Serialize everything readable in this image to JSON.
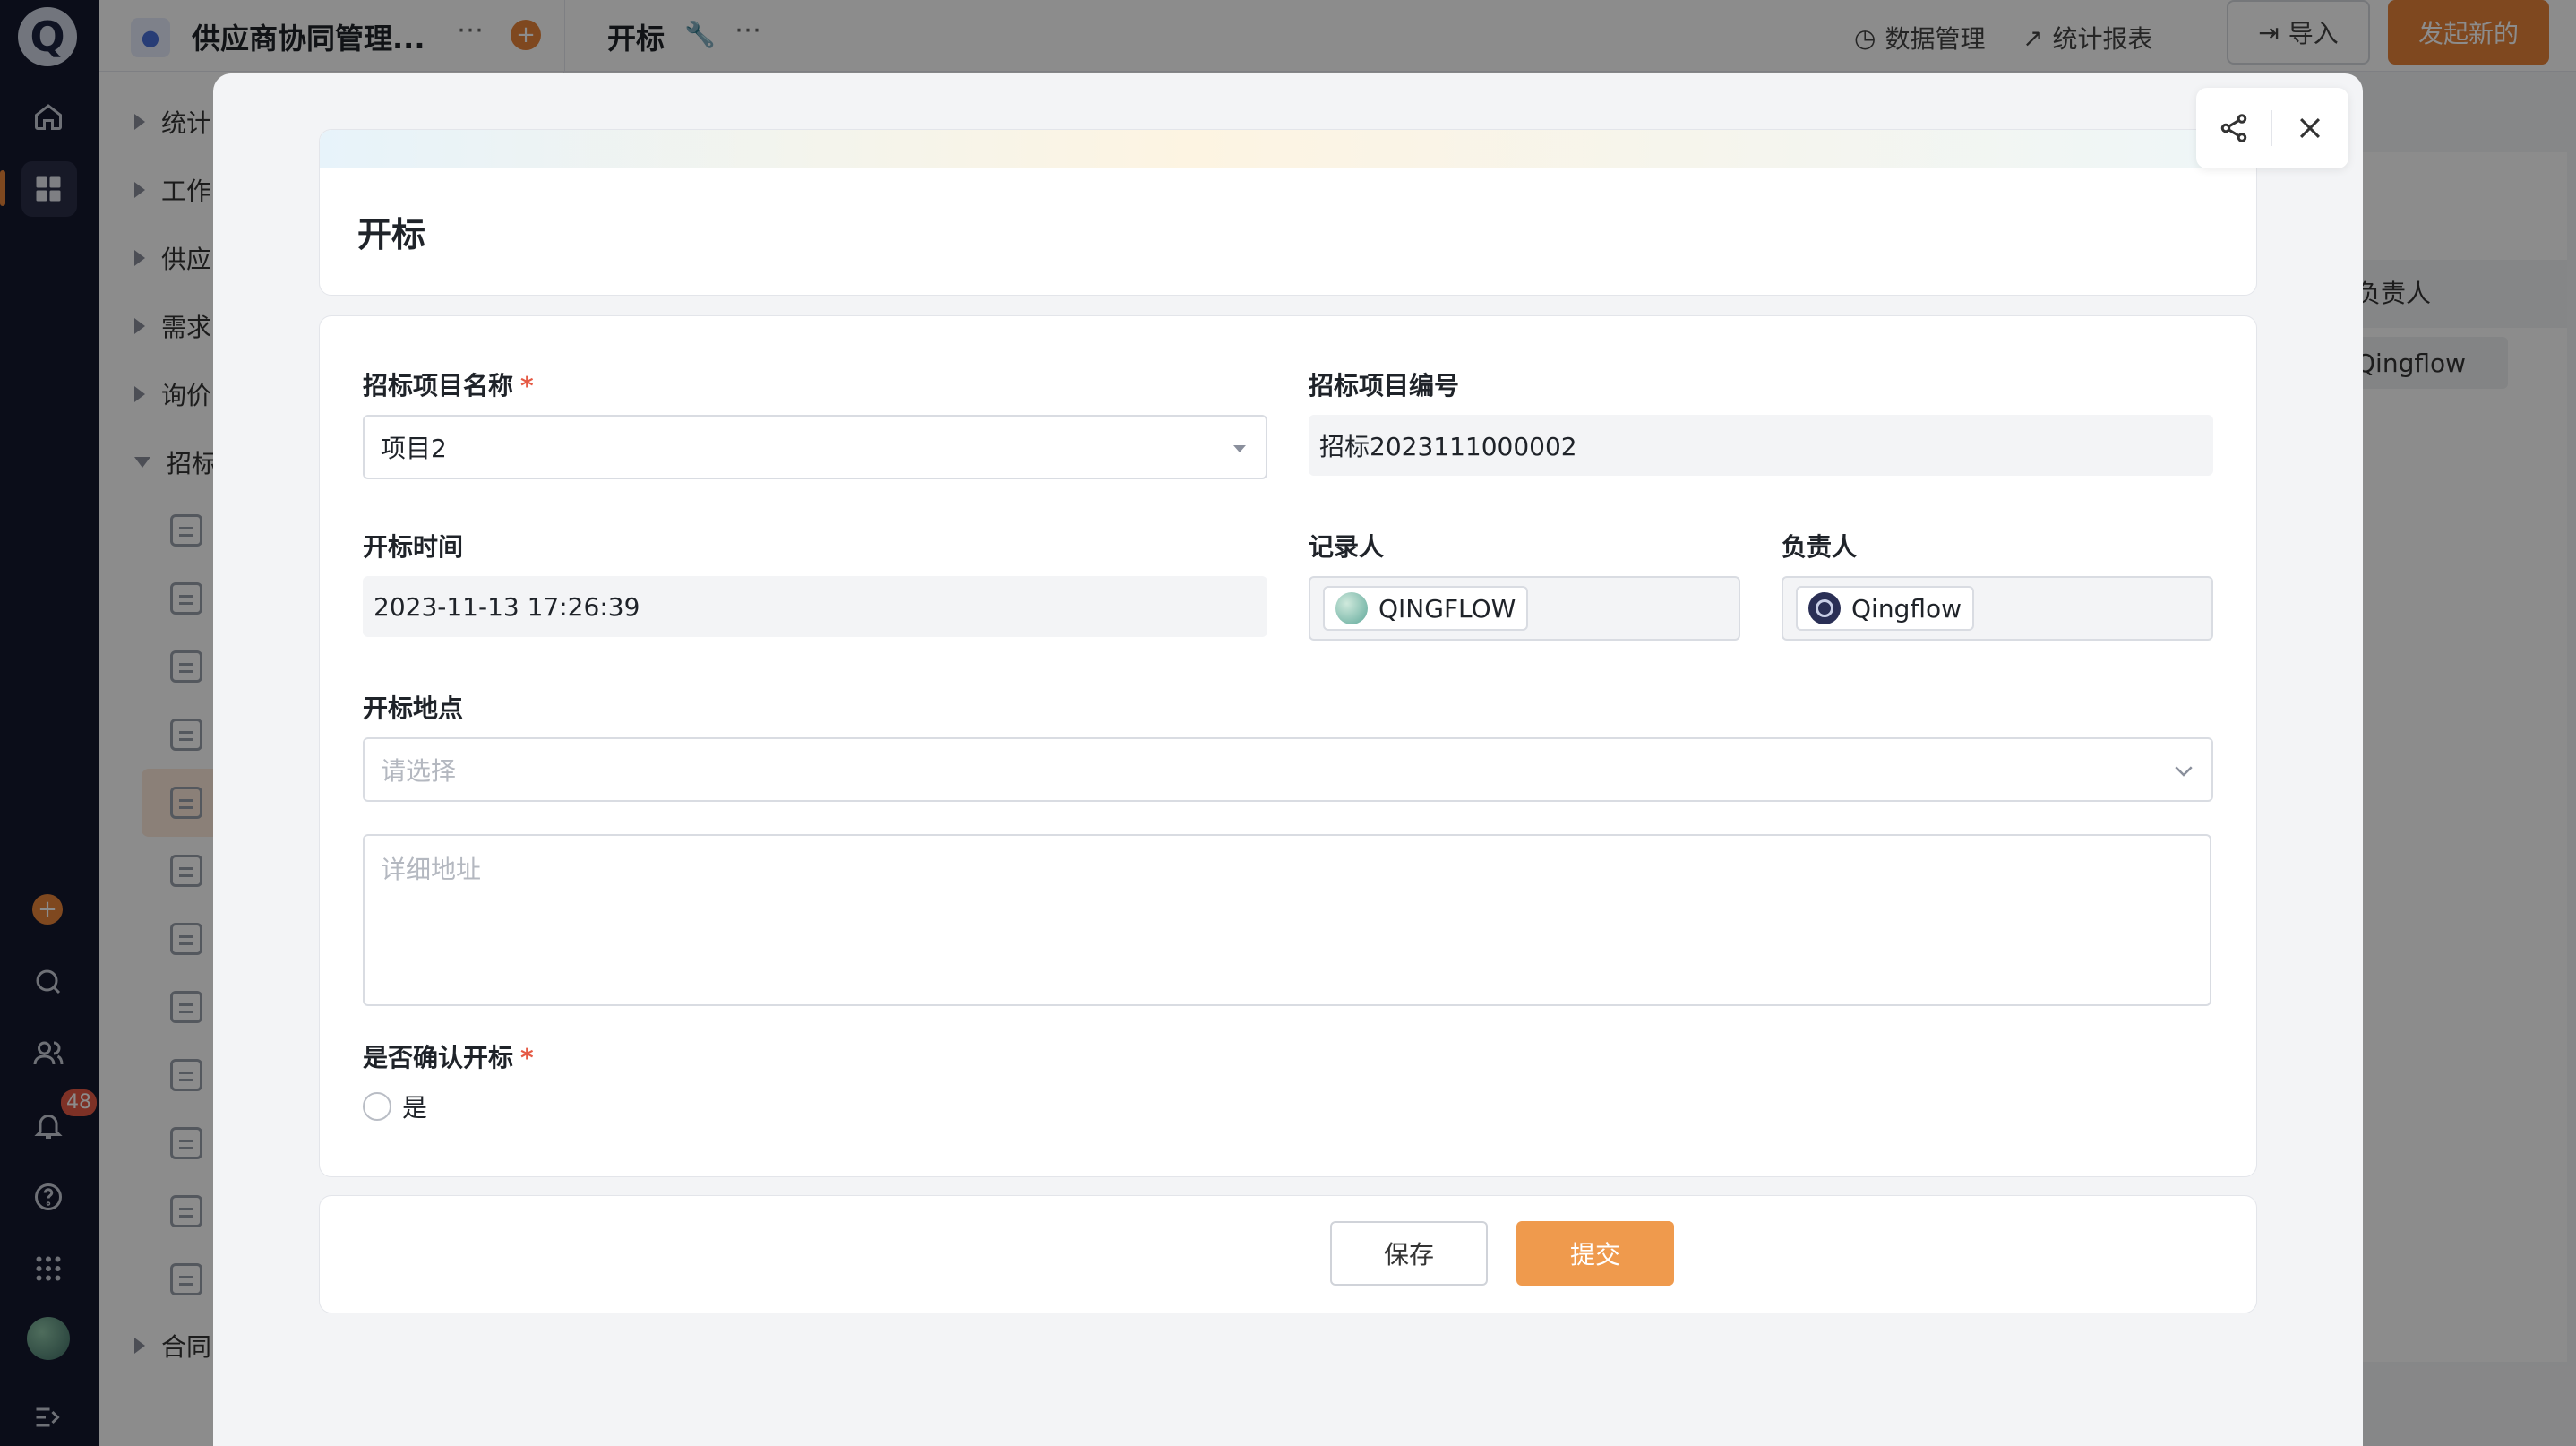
{
  "rail": {
    "logo": "Q",
    "notification_count": "48"
  },
  "sidebar": {
    "items": [
      {
        "label": "统计"
      },
      {
        "label": "工作"
      },
      {
        "label": "供应"
      },
      {
        "label": "需求"
      },
      {
        "label": "询价"
      },
      {
        "label": "招标"
      },
      {
        "label": "合同"
      }
    ]
  },
  "topbar": {
    "app_name": "供应商协同管理...",
    "page_title": "开标",
    "data_mgmt": "数据管理",
    "reports": "统计报表",
    "import": "导入",
    "new": "发起新的"
  },
  "background": {
    "column_header": "负责人",
    "owner_chip": "Qingflow"
  },
  "modal": {
    "title": "开标",
    "form": {
      "project_name_label": "招标项目名称",
      "project_name_value": "项目2",
      "project_no_label": "招标项目编号",
      "project_no_value": "招标2023111000002",
      "open_time_label": "开标时间",
      "open_time_value": "2023-11-13 17:26:39",
      "recorder_label": "记录人",
      "recorder_value": "QINGFLOW",
      "owner_label": "负责人",
      "owner_value": "Qingflow",
      "location_label": "开标地点",
      "location_placeholder": "请选择",
      "address_placeholder": "详细地址",
      "confirm_label": "是否确认开标",
      "confirm_option": "是",
      "required_mark": "*"
    },
    "actions": {
      "save": "保存",
      "submit": "提交"
    }
  },
  "colors": {
    "accent": "#e8833a",
    "submit": "#ef9a4d",
    "required": "#e55a45"
  }
}
